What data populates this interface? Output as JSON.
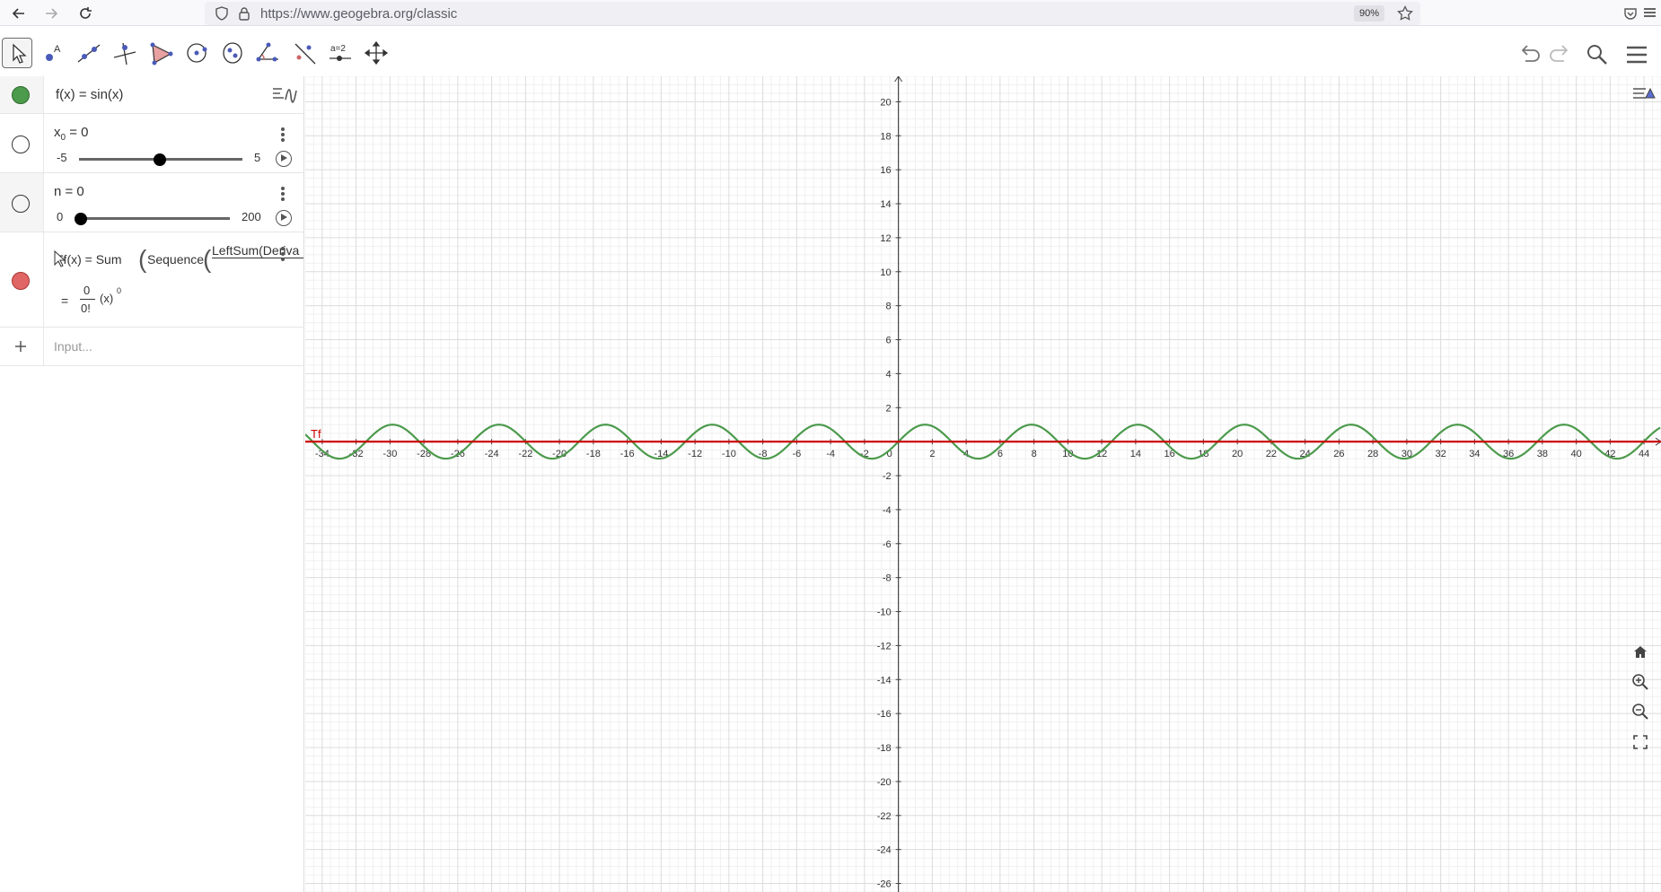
{
  "browser": {
    "url": "https://www.geogebra.org/classic",
    "zoom": "90%"
  },
  "toolbar": {
    "tools": [
      {
        "name": "move-tool",
        "active": true
      },
      {
        "name": "point-tool"
      },
      {
        "name": "line-tool"
      },
      {
        "name": "perpendicular-line-tool"
      },
      {
        "name": "polygon-tool"
      },
      {
        "name": "circle-center-point-tool"
      },
      {
        "name": "ellipse-tool"
      },
      {
        "name": "angle-tool"
      },
      {
        "name": "reflect-tool"
      },
      {
        "name": "slider-tool",
        "label": "a=2"
      },
      {
        "name": "move-graphics-view-tool"
      }
    ]
  },
  "algebra": {
    "f_row": {
      "text": "f(x)  =  sin(x)",
      "color": "#4c9a4c"
    },
    "x0_row": {
      "name": "x",
      "subscript": "0",
      "value": " = 0",
      "min": "-5",
      "max": "5",
      "position": 0.5
    },
    "n_row": {
      "name": "n = 0",
      "min": "0",
      "max": "200",
      "position": 0.0
    },
    "tf_row": {
      "lhs": "Tf(x)  =  Sum",
      "sequence": "Sequence",
      "leftsum": "LeftSum(Deriva",
      "result_eq": "=",
      "frac_num": "0",
      "frac_den": "0!",
      "power_base": "(x)",
      "power_exp": "0",
      "color": "#e06666"
    },
    "input_placeholder": "Input..."
  },
  "graph": {
    "x_ticks": [
      "-34",
      "-32",
      "-30",
      "-28",
      "-26",
      "-24",
      "-22",
      "-20",
      "-18",
      "-16",
      "-14",
      "-12",
      "-10",
      "-8",
      "-6",
      "-4",
      "-2",
      "0",
      "2",
      "4",
      "6",
      "8",
      "10",
      "12",
      "14",
      "16",
      "18",
      "20",
      "22",
      "24",
      "26",
      "28",
      "30",
      "32",
      "34",
      "36",
      "38",
      "40",
      "42",
      "44"
    ],
    "y_ticks": [
      "20",
      "18",
      "16",
      "14",
      "12",
      "10",
      "8",
      "6",
      "4",
      "2",
      "-2",
      "-4",
      "-6",
      "-8",
      "-10",
      "-12",
      "-14",
      "-16",
      "-18",
      "-20",
      "-22",
      "-24",
      "-26"
    ],
    "curve_label": "Tf",
    "sin_color": "#4c9a4c",
    "taylor_color": "#cc0000"
  },
  "chart_data": {
    "type": "line",
    "xlim": [
      -35,
      45
    ],
    "ylim": [
      -26.5,
      21.5
    ],
    "grid": true,
    "series": [
      {
        "name": "f",
        "function": "sin(x)",
        "color": "#4c9a4c"
      },
      {
        "name": "Tf",
        "function": "0",
        "color": "#cc0000"
      }
    ]
  }
}
